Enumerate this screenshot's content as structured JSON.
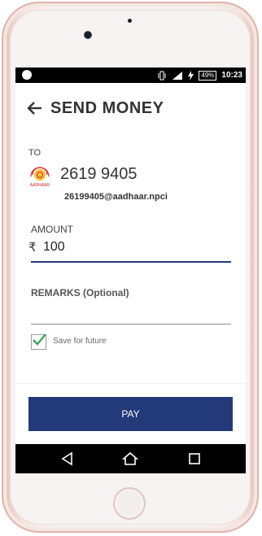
{
  "status_bar": {
    "battery": "49%",
    "time": "10:23"
  },
  "header": {
    "title": "SEND MONEY"
  },
  "recipient": {
    "to_label": "TO",
    "number": "2619 9405",
    "vpa": "26199405@aadhaar.npci",
    "logo_text": "AADHAAR"
  },
  "amount": {
    "label": "AMOUNT",
    "currency_symbol": "₹",
    "value": "100"
  },
  "remarks": {
    "label": "REMARKS (Optional)",
    "value": ""
  },
  "save_for_future": {
    "label": "Save for future",
    "checked": true
  },
  "pay_button": {
    "label": "PAY"
  },
  "colors": {
    "primary": "#233a7a",
    "check": "#3aa657"
  },
  "icons": [
    "back-arrow-icon",
    "vibrate-icon",
    "signal-icon",
    "charging-icon",
    "checkbox-checked-icon",
    "nav-back-icon",
    "nav-home-icon",
    "nav-recents-icon"
  ]
}
